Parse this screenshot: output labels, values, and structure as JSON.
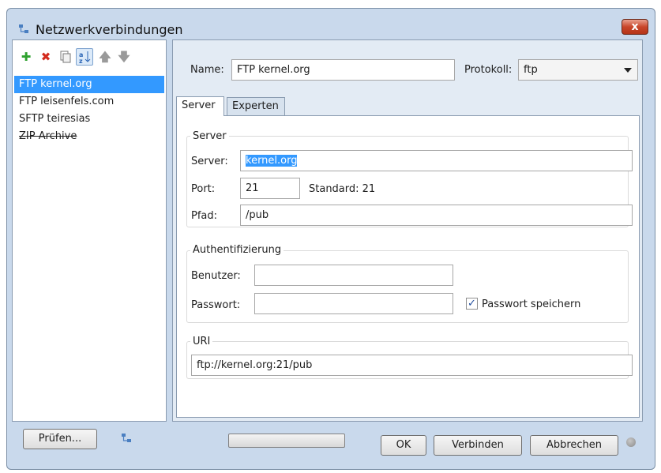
{
  "window": {
    "title": "Netzwerkverbindungen",
    "close_label": "x"
  },
  "connections": [
    {
      "label": "FTP kernel.org",
      "selected": true,
      "struck": false
    },
    {
      "label": "FTP leisenfels.com",
      "selected": false,
      "struck": false
    },
    {
      "label": "SFTP teiresias",
      "selected": false,
      "struck": false
    },
    {
      "label": "ZIP Archive",
      "selected": false,
      "struck": true
    }
  ],
  "toolbar": {
    "icons": [
      "add-icon",
      "delete-icon",
      "copy-icon",
      "sort-icon",
      "move-up-icon",
      "move-down-icon"
    ]
  },
  "left_footer": {
    "check_button": "Prüfen..."
  },
  "form": {
    "name_label": "Name:",
    "name_value": "FTP kernel.org",
    "protocol_label": "Protokoll:",
    "protocol_value": "ftp"
  },
  "tabs": [
    {
      "label": "Server",
      "active": true
    },
    {
      "label": "Experten",
      "active": false
    }
  ],
  "server_group": {
    "title": "Server",
    "server_label": "Server:",
    "server_value": "kernel.org",
    "port_label": "Port:",
    "port_value": "21",
    "default_label": "Standard: 21",
    "path_label": "Pfad:",
    "path_value": "/pub"
  },
  "auth_group": {
    "title": "Authentifizierung",
    "user_label": "Benutzer:",
    "user_value": "",
    "password_label": "Passwort:",
    "password_value": "",
    "save_password_label": "Passwort speichern",
    "save_password_checked": true
  },
  "uri_group": {
    "title": "URI",
    "uri_value": "ftp://kernel.org:21/pub"
  },
  "buttons": {
    "ok": "OK",
    "connect": "Verbinden",
    "cancel": "Abbrechen"
  },
  "progress": {
    "value": 0
  },
  "colors": {
    "selection": "#3399ff",
    "window_frame": "#c9d9ec",
    "close_button": "#c9462a"
  }
}
